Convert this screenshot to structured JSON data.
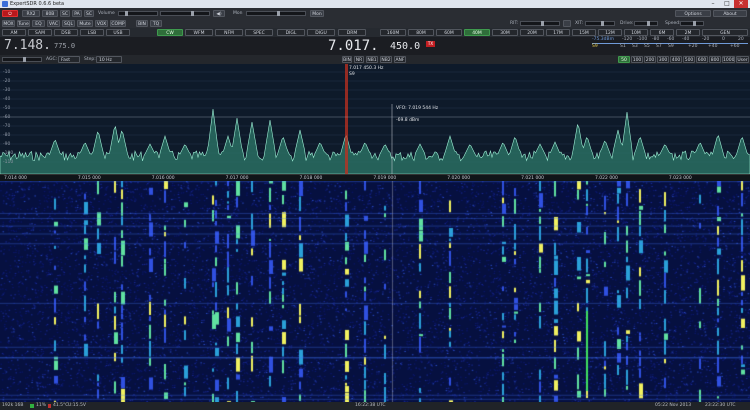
{
  "window": {
    "title": "ExpertSDR 0.6.6 beta",
    "minimize": "–",
    "maximize": "□",
    "close": "✕"
  },
  "toolbar1": {
    "power_icon": "power-icon",
    "rx_band": "RX2",
    "sample": "80B",
    "sc": "SC",
    "pa": "PA",
    "sc2": "SC",
    "volume_label": "Volume",
    "mon_label": "Mon",
    "mon_button": "Mon",
    "rit_label": "RIT:",
    "xit_label": "XIT:",
    "drive_label": "Drive:",
    "speed_label": "Speed:",
    "options": "Options",
    "about": "About",
    "speaker_icon": "speaker-icon"
  },
  "toolbar2": {
    "items": [
      "MOX",
      "Tune",
      "EQ",
      "VAC",
      "SQL",
      "Mute",
      "VOX",
      "COMP",
      "BIN",
      "TQ"
    ]
  },
  "modes": {
    "items": [
      "AM",
      "SAM",
      "DSB",
      "LSB",
      "USB",
      "CW",
      "WFM",
      "NFM",
      "SPEC",
      "DIGL",
      "DIGU",
      "DRM"
    ],
    "selected": "CW"
  },
  "bands": {
    "items": [
      "160M",
      "80M",
      "60M",
      "40M",
      "30M",
      "20M",
      "17M",
      "15M",
      "12M",
      "10M",
      "6M",
      "2M",
      "GEN"
    ],
    "selected": "40M"
  },
  "vfoA": {
    "main": "7.148.",
    "sub": "775.0"
  },
  "vfoB": {
    "main": "7.017.",
    "sub": "450.0",
    "tx": "TX"
  },
  "smeter": {
    "reading": "-75.3dBm",
    "s_label": "S9",
    "top_scale": [
      "-120",
      "-100",
      "-80",
      "-60",
      "-40",
      "-20",
      "0",
      "20"
    ],
    "bottom_scale": [
      "S9",
      "S1",
      "S3",
      "S5",
      "S7",
      "S9",
      "+20",
      "+40",
      "+60"
    ]
  },
  "controls3": {
    "agc_label": "AGC:",
    "agc_value": "Fast",
    "step_label": "Step:",
    "step_value": "10 Hz",
    "dsp": [
      "BIN",
      "NR",
      "NB1",
      "NB2",
      "ANF"
    ],
    "filters": [
      "50",
      "100",
      "200",
      "300",
      "400",
      "500",
      "600",
      "800",
      "1000",
      "User"
    ],
    "filter_selected": "50"
  },
  "panorama": {
    "db_labels": [
      "-10",
      "-20",
      "-30",
      "-40",
      "-50",
      "-60",
      "-70",
      "-80",
      "-90",
      "-100",
      "-110"
    ],
    "marker_line1": "7.017 450.3 Hz",
    "marker_line2": "S9",
    "cursor_line1": "VFO: 7.019 544 Hz",
    "cursor_line2": "-69.8 dBm",
    "freq_labels": [
      "7.014 000",
      "7.015 000",
      "7.016 000",
      "7.017 000",
      "7.018 000",
      "7.019 000",
      "7.020 000",
      "7.021 000",
      "7.022 000",
      "7.023 000"
    ]
  },
  "status": {
    "sample_rate": "192k 16B",
    "cpu": "11%",
    "temp": "41.5°C",
    "voltage": "U:15.5V",
    "center_time": "16:22:38 UTC",
    "date_local": "05:22 Nov 2013",
    "date_utc": "23:22:30 UTC"
  }
}
